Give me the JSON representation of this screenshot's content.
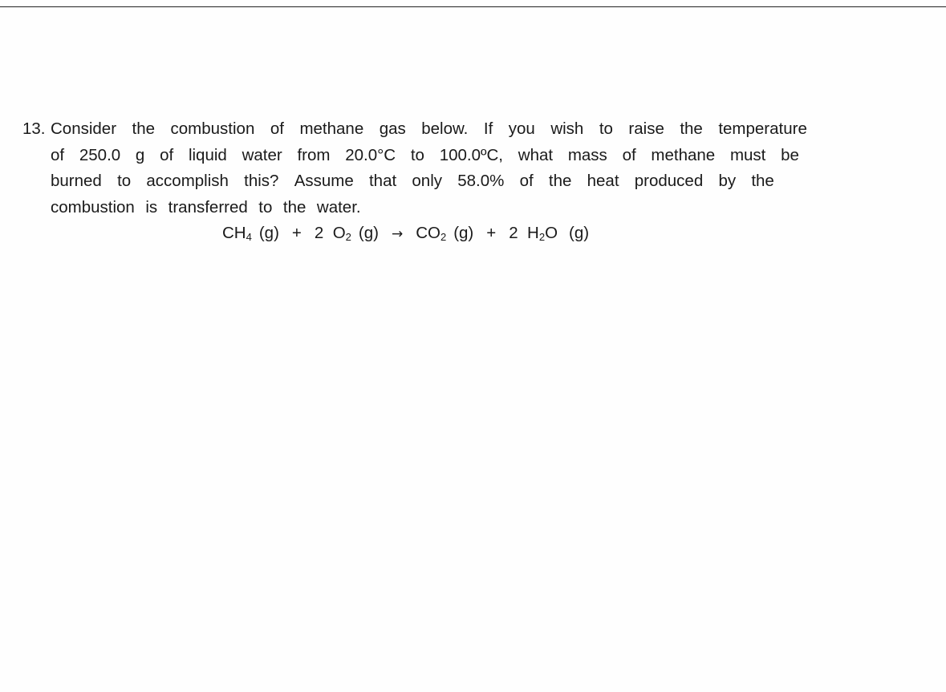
{
  "document": {
    "question_number": "13.",
    "lines": [
      [
        "Consider",
        "the",
        "combustion",
        "of",
        "methane",
        "gas",
        "below.",
        "If",
        "you",
        "wish",
        "to",
        "raise",
        "the",
        "temperature"
      ],
      [
        "of",
        "250.0",
        "g",
        "of",
        "liquid",
        "water",
        "from",
        "20.0°C",
        "to",
        "100.0ºC,",
        "what",
        "mass",
        "of",
        "methane",
        "must",
        "be"
      ],
      [
        "burned",
        "to",
        "accomplish",
        "this?",
        "Assume",
        "that",
        "only",
        "58.0%",
        "of",
        "the",
        "heat",
        "produced",
        "by",
        "the"
      ],
      [
        "combustion",
        "is",
        "transferred",
        "to",
        "the",
        "water."
      ]
    ],
    "equation": {
      "reactant1": {
        "formula": "CH",
        "subscript": "4",
        "state": "(g)"
      },
      "plus1": "+",
      "reactant2": {
        "coefficient": "2",
        "formula": "O",
        "subscript": "2",
        "state": "(g)"
      },
      "arrow": "→",
      "product1": {
        "formula": "CO",
        "subscript": "2",
        "state": "(g)"
      },
      "plus2": "+",
      "product2": {
        "coefficient": "2",
        "formula_pre": "H",
        "subscript": "2",
        "formula_post": "O",
        "state": "(g)"
      }
    }
  }
}
